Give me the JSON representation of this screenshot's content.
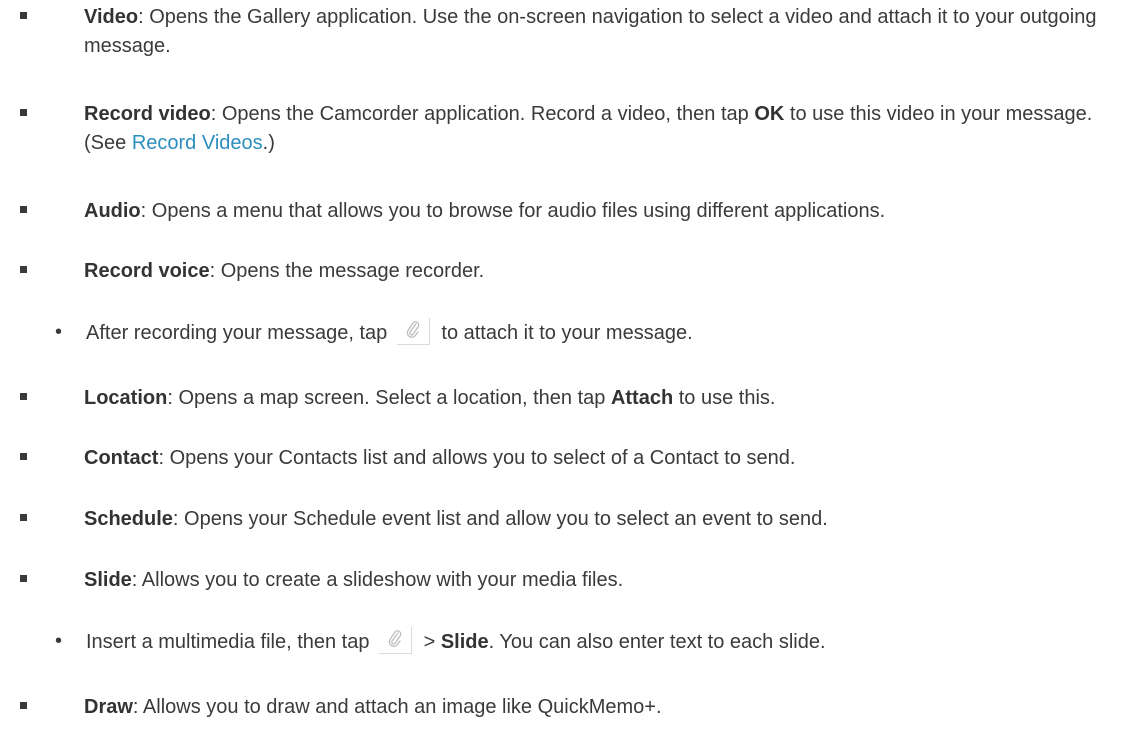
{
  "items": [
    {
      "term": "Video",
      "rest": ": Opens the Gallery application. Use the on-screen navigation to select a video and attach it to your outgoing message."
    },
    {
      "term": "Record video",
      "mid1": ": Opens the Camcorder application. Record a video, then tap ",
      "bold2": "OK",
      "mid2": " to use this video in your message. (See ",
      "link": "Record Videos",
      "end": ".)"
    },
    {
      "term": "Audio",
      "rest": ": Opens a menu that allows you to browse for audio files using different applications."
    },
    {
      "term": "Record voice",
      "rest": ": Opens the message recorder."
    },
    {
      "sub_before": "After recording your message, tap ",
      "sub_after": " to attach it to your message."
    },
    {
      "term": "Location",
      "mid1": ": Opens a map screen. Select a location, then tap ",
      "bold2": "Attach",
      "mid2": " to use this."
    },
    {
      "term": "Contact",
      "rest": ": Opens your Contacts list and allows you to select of a Contact to send."
    },
    {
      "term": "Schedule",
      "rest": ": Opens your Schedule event list and allow you to select an event to send."
    },
    {
      "term": "Slide",
      "rest": ": Allows you to create a slideshow with your media files."
    },
    {
      "sub_before": "Insert a multimedia file, then tap ",
      "sub_mid": " > ",
      "sub_bold": "Slide",
      "sub_after": ". You can also enter text to each slide."
    },
    {
      "term": "Draw",
      "rest": ": Allows you to draw and attach an image like QuickMemo+."
    }
  ],
  "icons": {
    "attach": "paperclip-icon"
  }
}
